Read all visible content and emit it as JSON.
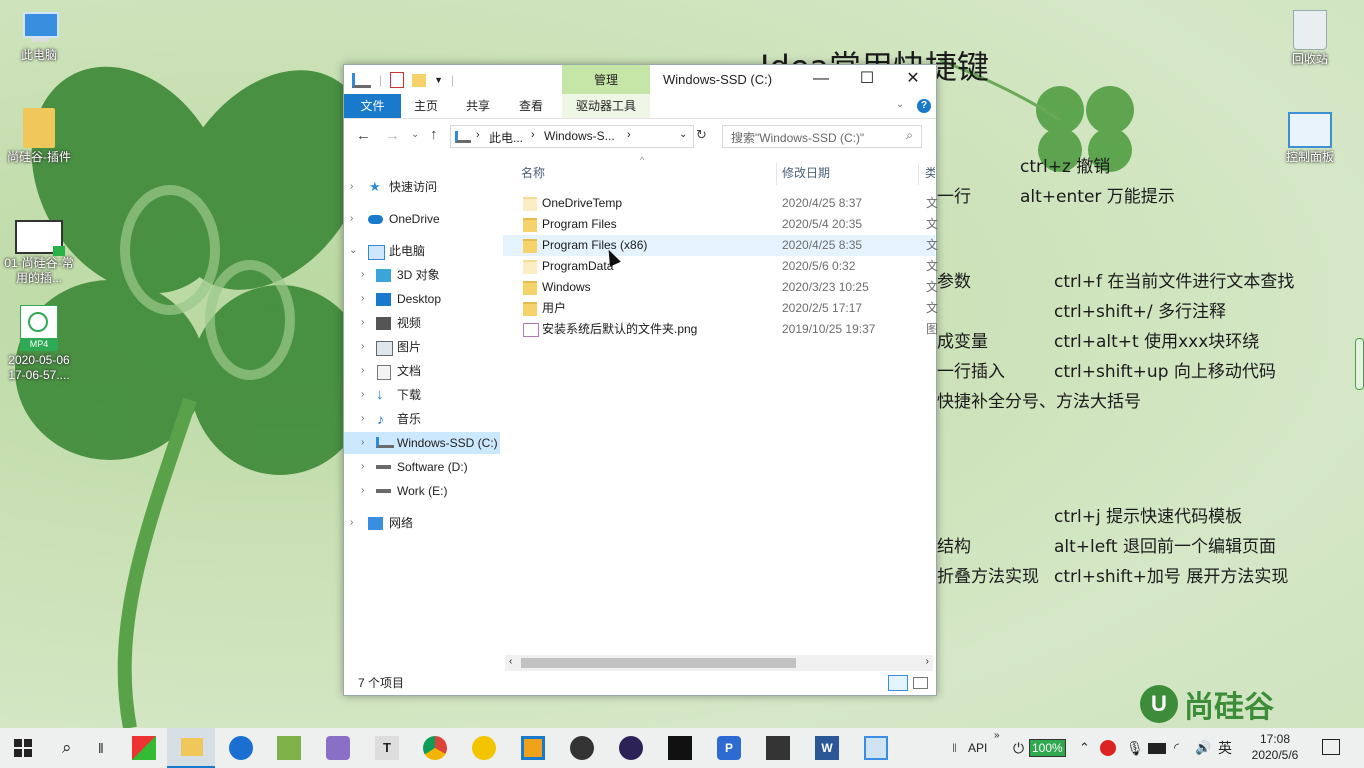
{
  "desktop": {
    "icons": [
      {
        "label": "此电脑"
      },
      {
        "label": "尚硅谷-插件"
      },
      {
        "label": "01-尚硅谷-常用的插..."
      },
      {
        "label": "2020-05-06 17-06-57...."
      },
      {
        "label": "回收站"
      },
      {
        "label": "控制面板"
      }
    ],
    "mp4_badge": "MP4",
    "background_text": {
      "title": "Idea常用快捷键",
      "lines": [
        "ctrl+z 撤销",
        "一行",
        "alt+enter 万能提示",
        "参数",
        "ctrl+f 在当前文件进行文本查找",
        "ctrl+shift+/ 多行注释",
        "成变量",
        "ctrl+alt+t 使用xxx块环绕",
        "一行插入",
        "ctrl+shift+up 向上移动代码",
        "快捷补全分号、方法大括号",
        "ctrl+j 提示快速代码模板",
        "结构",
        "alt+left 退回前一个编辑页面",
        "折叠方法实现",
        "ctrl+shift+加号 展开方法实现"
      ],
      "logo": "尚硅谷"
    }
  },
  "explorer": {
    "context_tab": "管理",
    "title": "Windows-SSD (C:)",
    "window_buttons": {
      "minimize": "—",
      "maximize": "☐",
      "close": "✕"
    },
    "ribbon_tabs": [
      "文件",
      "主页",
      "共享",
      "查看",
      "驱动器工具"
    ],
    "address": {
      "segments": [
        "此电...",
        "Windows-S..."
      ]
    },
    "search_placeholder": "搜索\"Windows-SSD (C:)\"",
    "nav_items": [
      {
        "label": "快速访问"
      },
      {
        "label": "OneDrive"
      },
      {
        "label": "此电脑"
      },
      {
        "label": "3D 对象"
      },
      {
        "label": "Desktop"
      },
      {
        "label": "视频"
      },
      {
        "label": "图片"
      },
      {
        "label": "文档"
      },
      {
        "label": "下载"
      },
      {
        "label": "音乐"
      },
      {
        "label": "Windows-SSD (C:)"
      },
      {
        "label": "Software (D:)"
      },
      {
        "label": "Work (E:)"
      },
      {
        "label": "网络"
      }
    ],
    "columns": {
      "name": "名称",
      "date": "修改日期",
      "type": "类"
    },
    "files": [
      {
        "name": "OneDriveTemp",
        "date": "2020/4/25 8:37",
        "type": "文"
      },
      {
        "name": "Program Files",
        "date": "2020/5/4 20:35",
        "type": "文"
      },
      {
        "name": "Program Files (x86)",
        "date": "2020/4/25 8:35",
        "type": "文"
      },
      {
        "name": "ProgramData",
        "date": "2020/5/6 0:32",
        "type": "文"
      },
      {
        "name": "Windows",
        "date": "2020/3/23 10:25",
        "type": "文"
      },
      {
        "name": "用户",
        "date": "2020/2/5 17:17",
        "type": "文"
      },
      {
        "name": "安装系统后默认的文件夹.png",
        "date": "2019/10/25 19:37",
        "type": "图"
      }
    ],
    "status": "7 个项目"
  },
  "taskbar": {
    "tray": {
      "api": "API",
      "battery": "100%",
      "ime": "英",
      "time": "17:08",
      "date": "2020/5/6"
    }
  }
}
